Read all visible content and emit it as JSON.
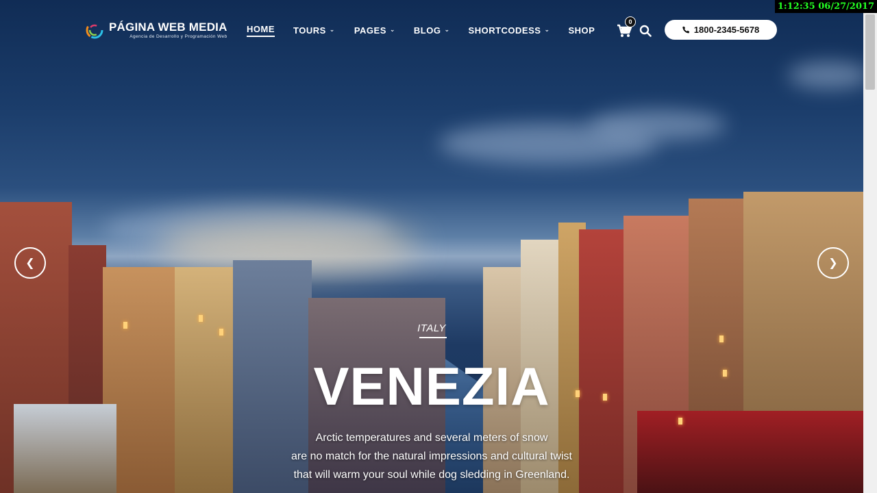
{
  "brand": {
    "title": "PÁGINA WEB MEDIA",
    "subtitle": "Agencia de Desarrollo y Programación Web",
    "logo_icon": "swirl-logo-icon"
  },
  "nav": {
    "items": [
      {
        "label": "HOME",
        "active": true,
        "dropdown": false
      },
      {
        "label": "TOURS",
        "active": false,
        "dropdown": true
      },
      {
        "label": "PAGES",
        "active": false,
        "dropdown": true
      },
      {
        "label": "BLOG",
        "active": false,
        "dropdown": true
      },
      {
        "label": "SHORTCODESS",
        "active": false,
        "dropdown": true
      },
      {
        "label": "SHOP",
        "active": false,
        "dropdown": false
      }
    ]
  },
  "cart": {
    "count": "0",
    "icon": "cart-icon"
  },
  "search": {
    "icon": "search-icon"
  },
  "phone": {
    "number": "1800-2345-5678",
    "icon": "phone-icon"
  },
  "slider": {
    "prev_icon": "chevron-left-icon",
    "next_icon": "chevron-right-icon",
    "country": "ITALY",
    "title": "VENEZIA",
    "text_lines": [
      "Arctic temperatures and several meters of snow",
      "are no match for the natural impressions and cultural twist",
      "that will warm your soul while dog sledding in Greenland."
    ]
  },
  "overlay": {
    "timestamp": "1:12:35  06/27/2017"
  },
  "colors": {
    "timestamp_text": "#23ff23",
    "sky": "#1b3d6b",
    "accent_lights": "#ffd27a"
  }
}
